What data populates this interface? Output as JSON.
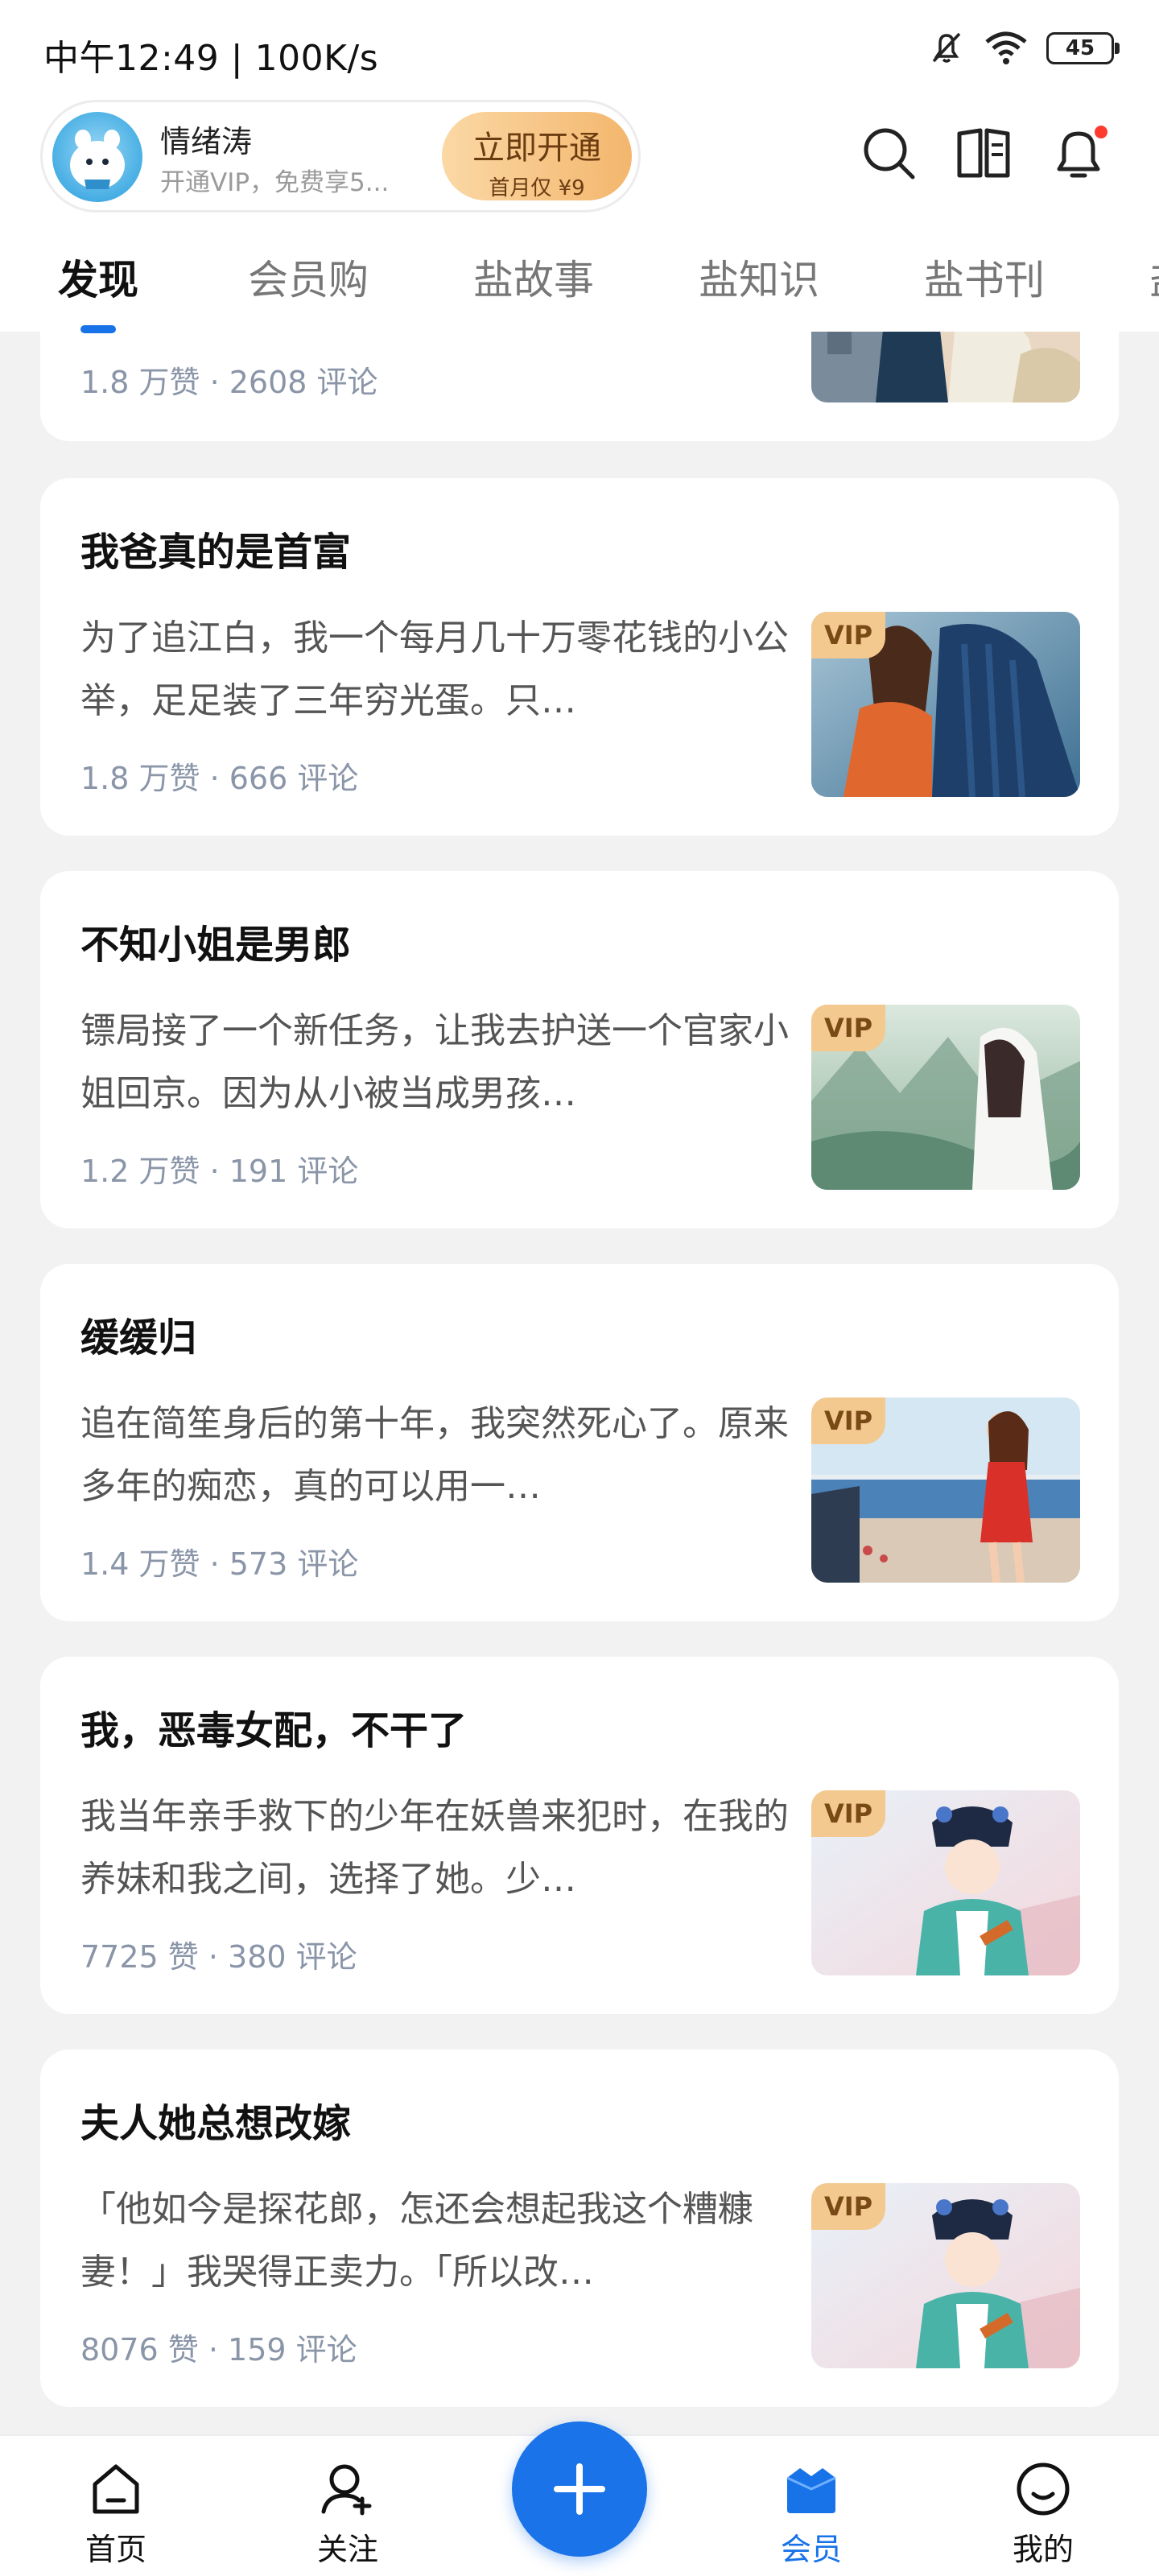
{
  "status_bar": {
    "time": "中午12:49 | 100K/s",
    "battery": "45"
  },
  "vip_banner": {
    "user_name": "情绪涛",
    "subtitle": "开通VIP，免费享5...",
    "button_main": "立即开通",
    "button_sub": "首月仅 ¥9"
  },
  "tabs": [
    "发现",
    "会员购",
    "盐故事",
    "盐知识",
    "盐书刊",
    "盐"
  ],
  "cards": [
    {
      "title": "",
      "excerpt": "",
      "meta": "1.8 万赞 · 2608 评论",
      "vip": false
    },
    {
      "title": "我爸真的是首富",
      "excerpt": "为了追江白，我一个每月几十万零花钱的小公举，足足装了三年穷光蛋。只…",
      "meta": "1.8 万赞 · 666 评论",
      "vip": true,
      "vip_label": "VIP"
    },
    {
      "title": "不知小姐是男郎",
      "excerpt": "镖局接了一个新任务，让我去护送一个官家小姐回京。因为从小被当成男孩…",
      "meta": "1.2 万赞 · 191 评论",
      "vip": true,
      "vip_label": "VIP"
    },
    {
      "title": "缓缓归",
      "excerpt": "追在简笙身后的第十年，我突然死心了。原来多年的痴恋，真的可以用一…",
      "meta": "1.4 万赞 · 573 评论",
      "vip": true,
      "vip_label": "VIP"
    },
    {
      "title": "我，恶毒女配，不干了",
      "excerpt": "我当年亲手救下的少年在妖兽来犯时，在我的养妹和我之间，选择了她。少…",
      "meta": "7725 赞 · 380 评论",
      "vip": true,
      "vip_label": "VIP"
    },
    {
      "title": "夫人她总想改嫁",
      "excerpt": "「他如今是探花郎，怎还会想起我这个糟糠妻！」我哭得正卖力。「所以改…",
      "meta": "8076 赞 · 159 评论",
      "vip": true,
      "vip_label": "VIP"
    }
  ],
  "bottom_nav": [
    {
      "label": "首页",
      "icon": "home-icon"
    },
    {
      "label": "关注",
      "icon": "follow-icon"
    },
    {
      "label": "",
      "icon": "plus-icon"
    },
    {
      "label": "会员",
      "icon": "member-icon"
    },
    {
      "label": "我的",
      "icon": "profile-icon"
    }
  ],
  "colors": {
    "accent": "#1872e8",
    "vip_gold": "#f3c98f",
    "meta_text": "#8a95a8"
  }
}
